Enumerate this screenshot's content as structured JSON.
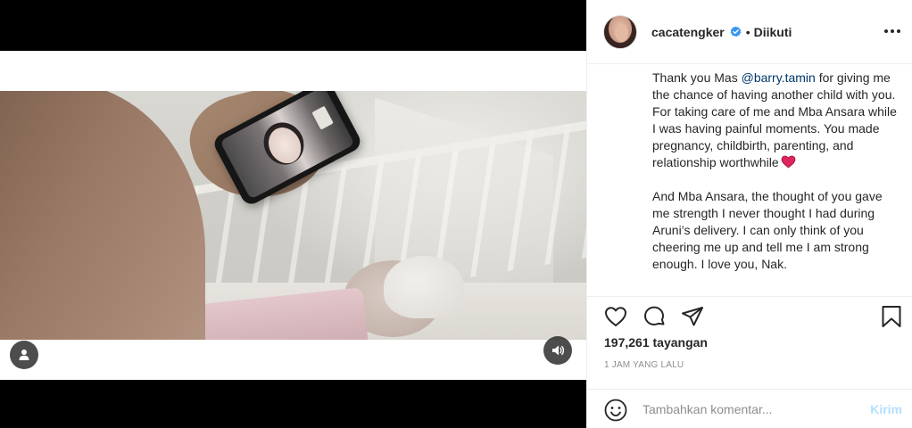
{
  "post": {
    "username": "cacatengker",
    "separator": "•",
    "follow_status": "Diikuti",
    "caption": {
      "line_a_before": "Thank you Mas ",
      "mention": "@barry.tamin",
      "line_a_after": " for giving me the chance of having another child with you. For taking care of me and Mba Ansara while I was having painful moments. You made pregnancy, childbirth, parenting, and relationship worthwhile",
      "line_b": "And Mba Ansara, the thought of you gave me strength I never thought I had during Aruni’s delivery. I can only think of you cheering me up and tell me I am strong enough. I love you, Nak."
    },
    "views": "197,261 tayangan",
    "timestamp": "1 JAM YANG LALU"
  },
  "comment": {
    "placeholder": "Tambahkan komentar...",
    "post_label": "Kirim"
  },
  "icons": {
    "verified": "verified-badge-icon",
    "more": "more-options-icon",
    "like": "heart-outline-icon",
    "comment": "comment-bubble-icon",
    "share": "paper-plane-icon",
    "save": "bookmark-icon",
    "emoji": "smiley-icon",
    "tag": "user-tag-icon",
    "sound": "speaker-icon",
    "caption_emoji": "red-heart-emoji"
  },
  "colors": {
    "verified": "#3897f0",
    "mention": "#00376b",
    "post_button_disabled": "#b2dffc",
    "heart_emoji": "#e0245e",
    "secondary_text": "#8e8e8e"
  }
}
